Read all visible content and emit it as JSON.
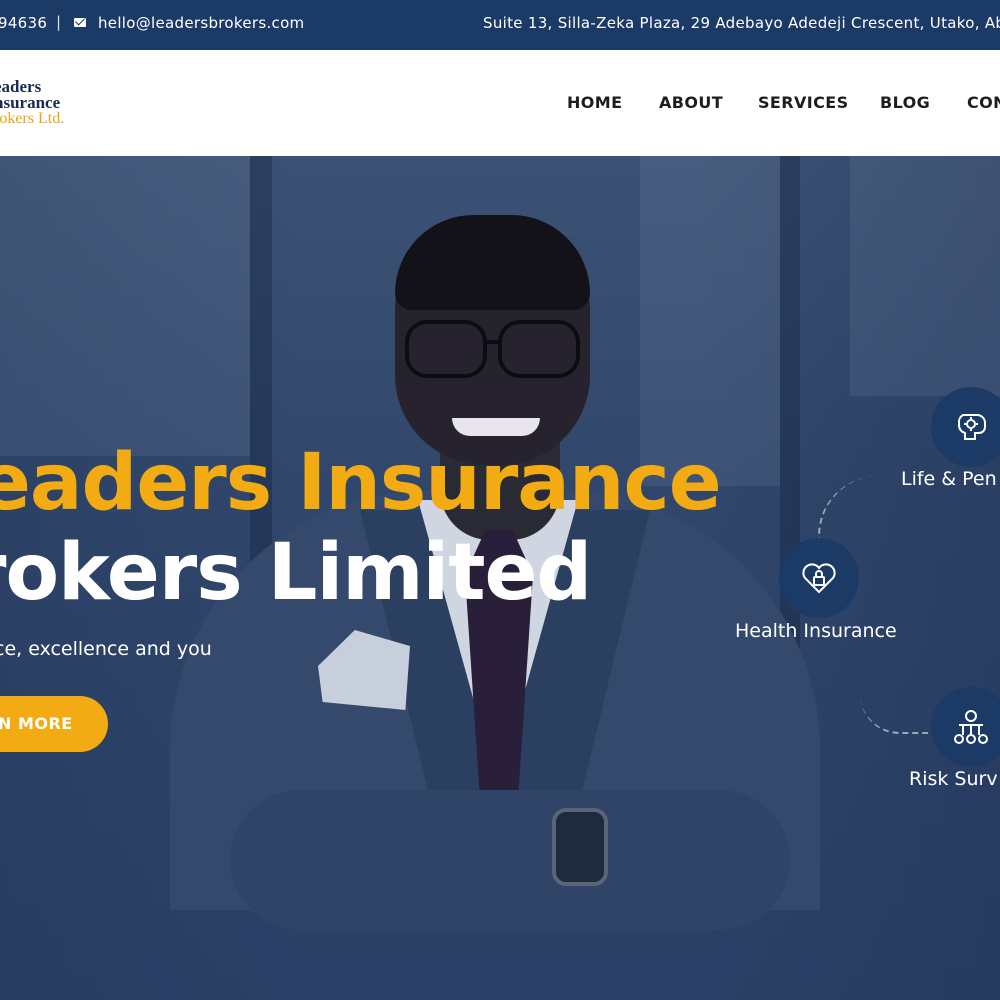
{
  "topbar": {
    "phone": "94636",
    "separator": "|",
    "email": "hello@leadersbrokers.com",
    "address": "Suite 13, Silla-Zeka Plaza, 29 Adebayo Adedeji Crescent, Utako, Ab"
  },
  "logo": {
    "line1": "eaders",
    "line2": "nsurance",
    "line3": "rokers Ltd."
  },
  "nav": {
    "home": "HOME",
    "about": "ABOUT",
    "services": "SERVICES",
    "blog": "BLOG",
    "contact": "CON"
  },
  "hero": {
    "title_line1": "eaders Insurance",
    "title_line2": "rokers Limited",
    "tagline": "ce, excellence and you",
    "cta_label": "N MORE"
  },
  "services": [
    {
      "label": "Life & Pen",
      "icon": "brain-gear-icon"
    },
    {
      "label": "Health Insurance",
      "icon": "heart-lock-icon"
    },
    {
      "label": "Risk Surv",
      "icon": "money-people-icon"
    }
  ],
  "colors": {
    "topbar": "#1c3a66",
    "accent": "#f2ab12",
    "circle": "#1c3a66"
  }
}
